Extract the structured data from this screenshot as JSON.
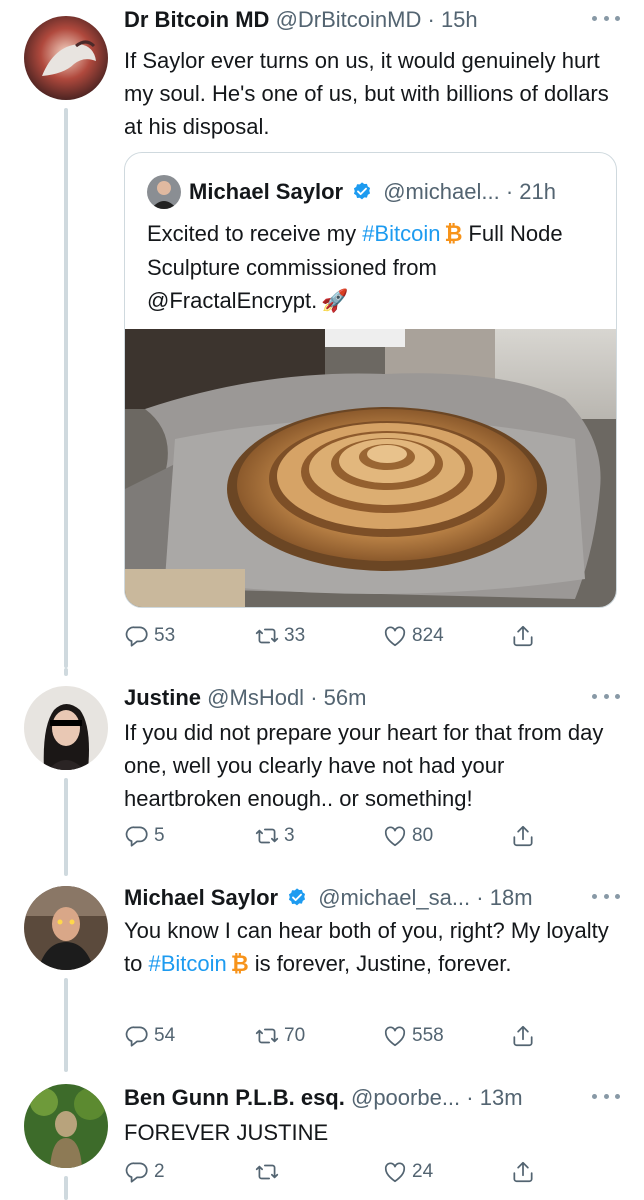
{
  "tweets": [
    {
      "name": "Dr Bitcoin MD",
      "handle": "@DrBitcoinMD",
      "time": "· 15h",
      "text": "If Saylor ever turns on us, it would genuinely hurt my soul. He's one of us, but with billions of dollars at his disposal.",
      "quote": {
        "name": "Michael Saylor",
        "handle": "@michael...",
        "time": "· 21h",
        "text_before": "Excited to receive my ",
        "hashtag": "#Bitcoin",
        "text_mid": "Full Node Sculpture commissioned from ",
        "mention": "@FractalEncrypt",
        "text_after": ".",
        "emoji": "🚀"
      },
      "replies": "53",
      "retweets": "33",
      "likes": "824"
    },
    {
      "name": "Justine",
      "handle": "@MsHodl",
      "time": "· 56m",
      "text": "If you did not prepare your heart for that from day one, well you clearly have not had your heartbroken enough.. or something!",
      "replies": "5",
      "retweets": "3",
      "likes": "80"
    },
    {
      "name": "Michael Saylor",
      "handle": "@michael_sa...",
      "time": "· 18m",
      "text_before": "You know I can hear both of you, right? My loyalty to ",
      "hashtag": "#Bitcoin",
      "text_after": "is forever, Justine, forever.",
      "replies": "54",
      "retweets": "70",
      "likes": "558"
    },
    {
      "name": "Ben Gunn P.L.B. esq.",
      "handle": "@poorbe...",
      "time": "· 13m",
      "text": "FOREVER JUSTINE",
      "replies": "2",
      "retweets": "",
      "likes": "24"
    }
  ],
  "bitcoin_symbol": "₿",
  "colors": {
    "link": "#1d9bf0",
    "bitcoin": "#f7931a",
    "muted": "#536471",
    "border": "#cfd9de"
  },
  "icons": [
    "more-icon",
    "verified-badge-icon",
    "reply-icon",
    "retweet-icon",
    "like-icon",
    "share-icon",
    "rocket-emoji"
  ]
}
